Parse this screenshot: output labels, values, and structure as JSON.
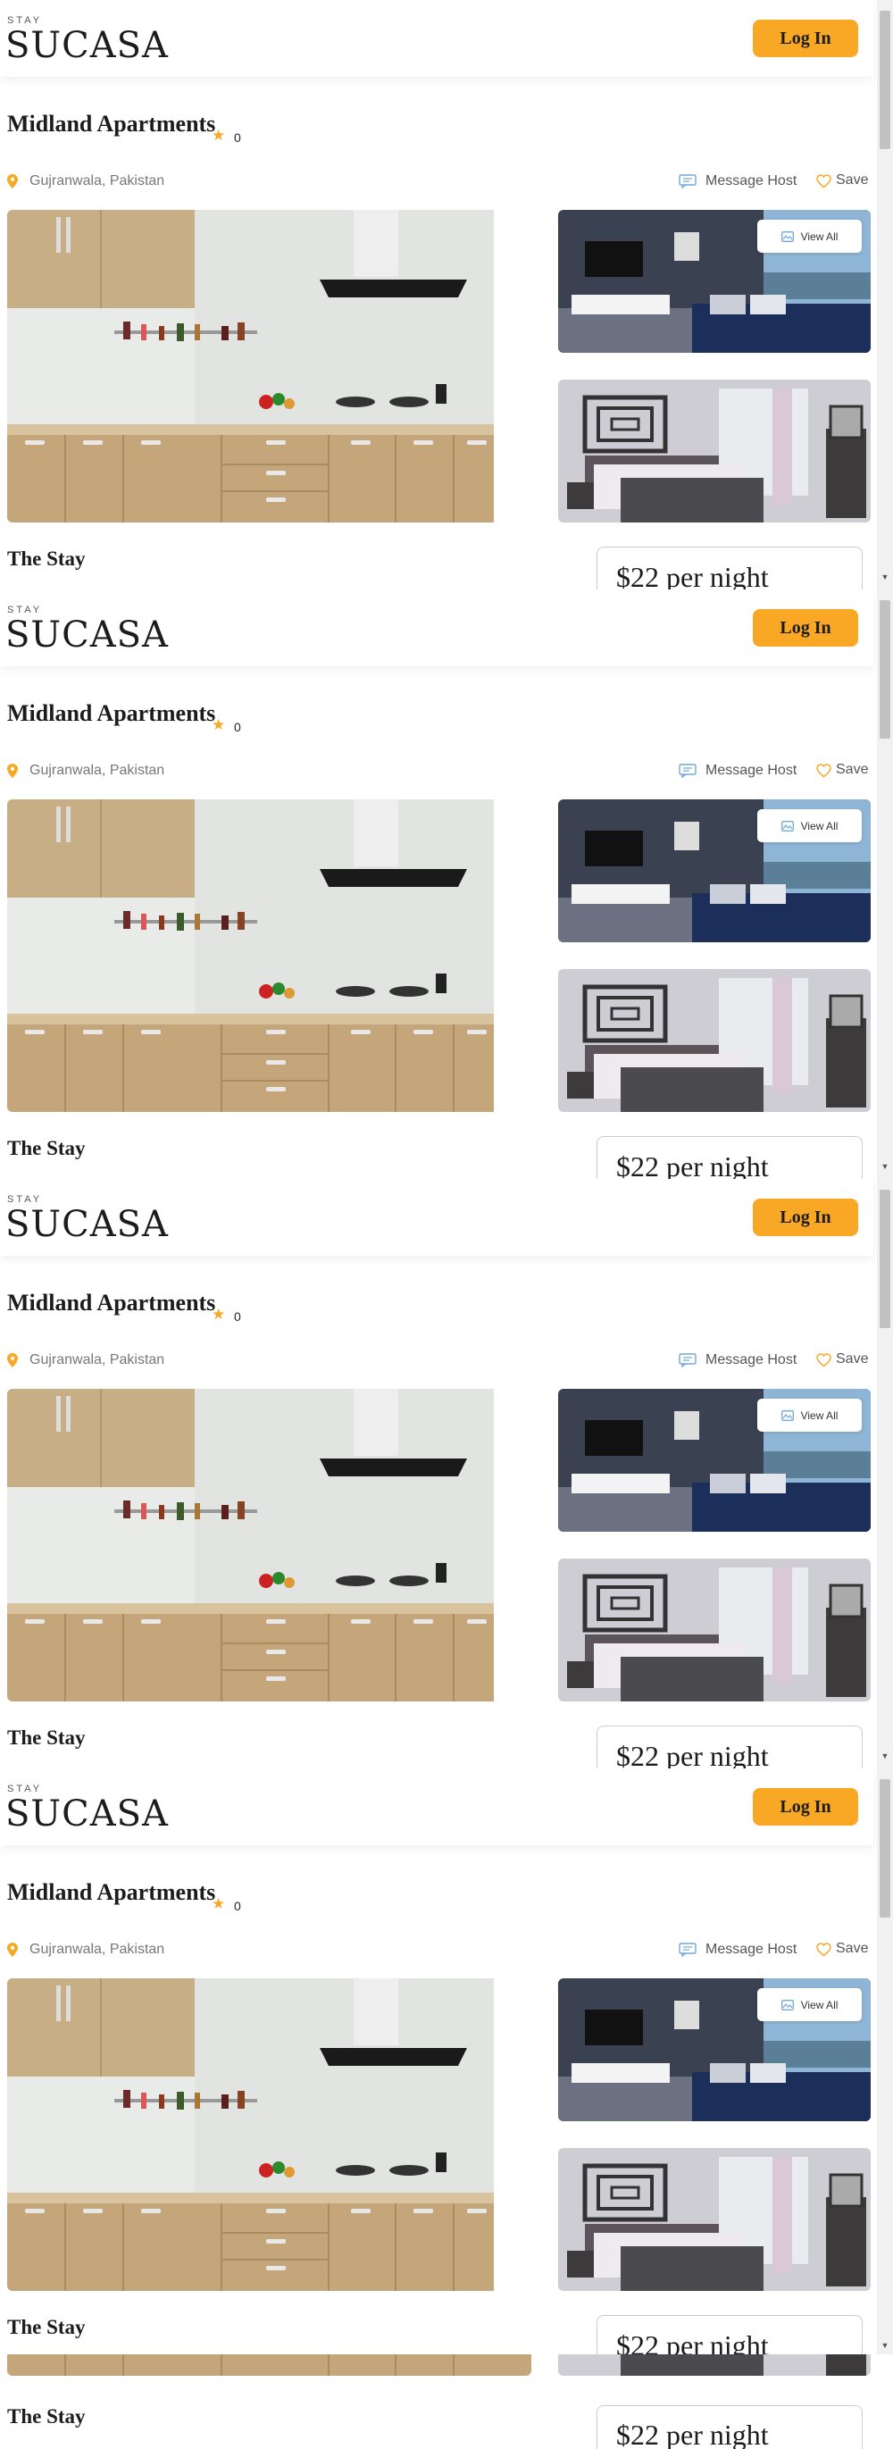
{
  "header": {
    "brand_small": "STAY",
    "brand": "SUCASA",
    "login_label": "Log In"
  },
  "listing": {
    "title": "Midland Apartments",
    "rating": "0",
    "location": "Gujranwala, Pakistan",
    "message_host": "Message Host",
    "save": "Save",
    "view_all": "View All",
    "section_title": "The Stay",
    "price": "$22 per night"
  },
  "colors": {
    "accent": "#f9a826",
    "text": "#1c1c1c",
    "muted": "#777777"
  },
  "icons": [
    "location-pin-icon",
    "message-icon",
    "heart-icon",
    "star-icon",
    "image-gallery-icon"
  ]
}
